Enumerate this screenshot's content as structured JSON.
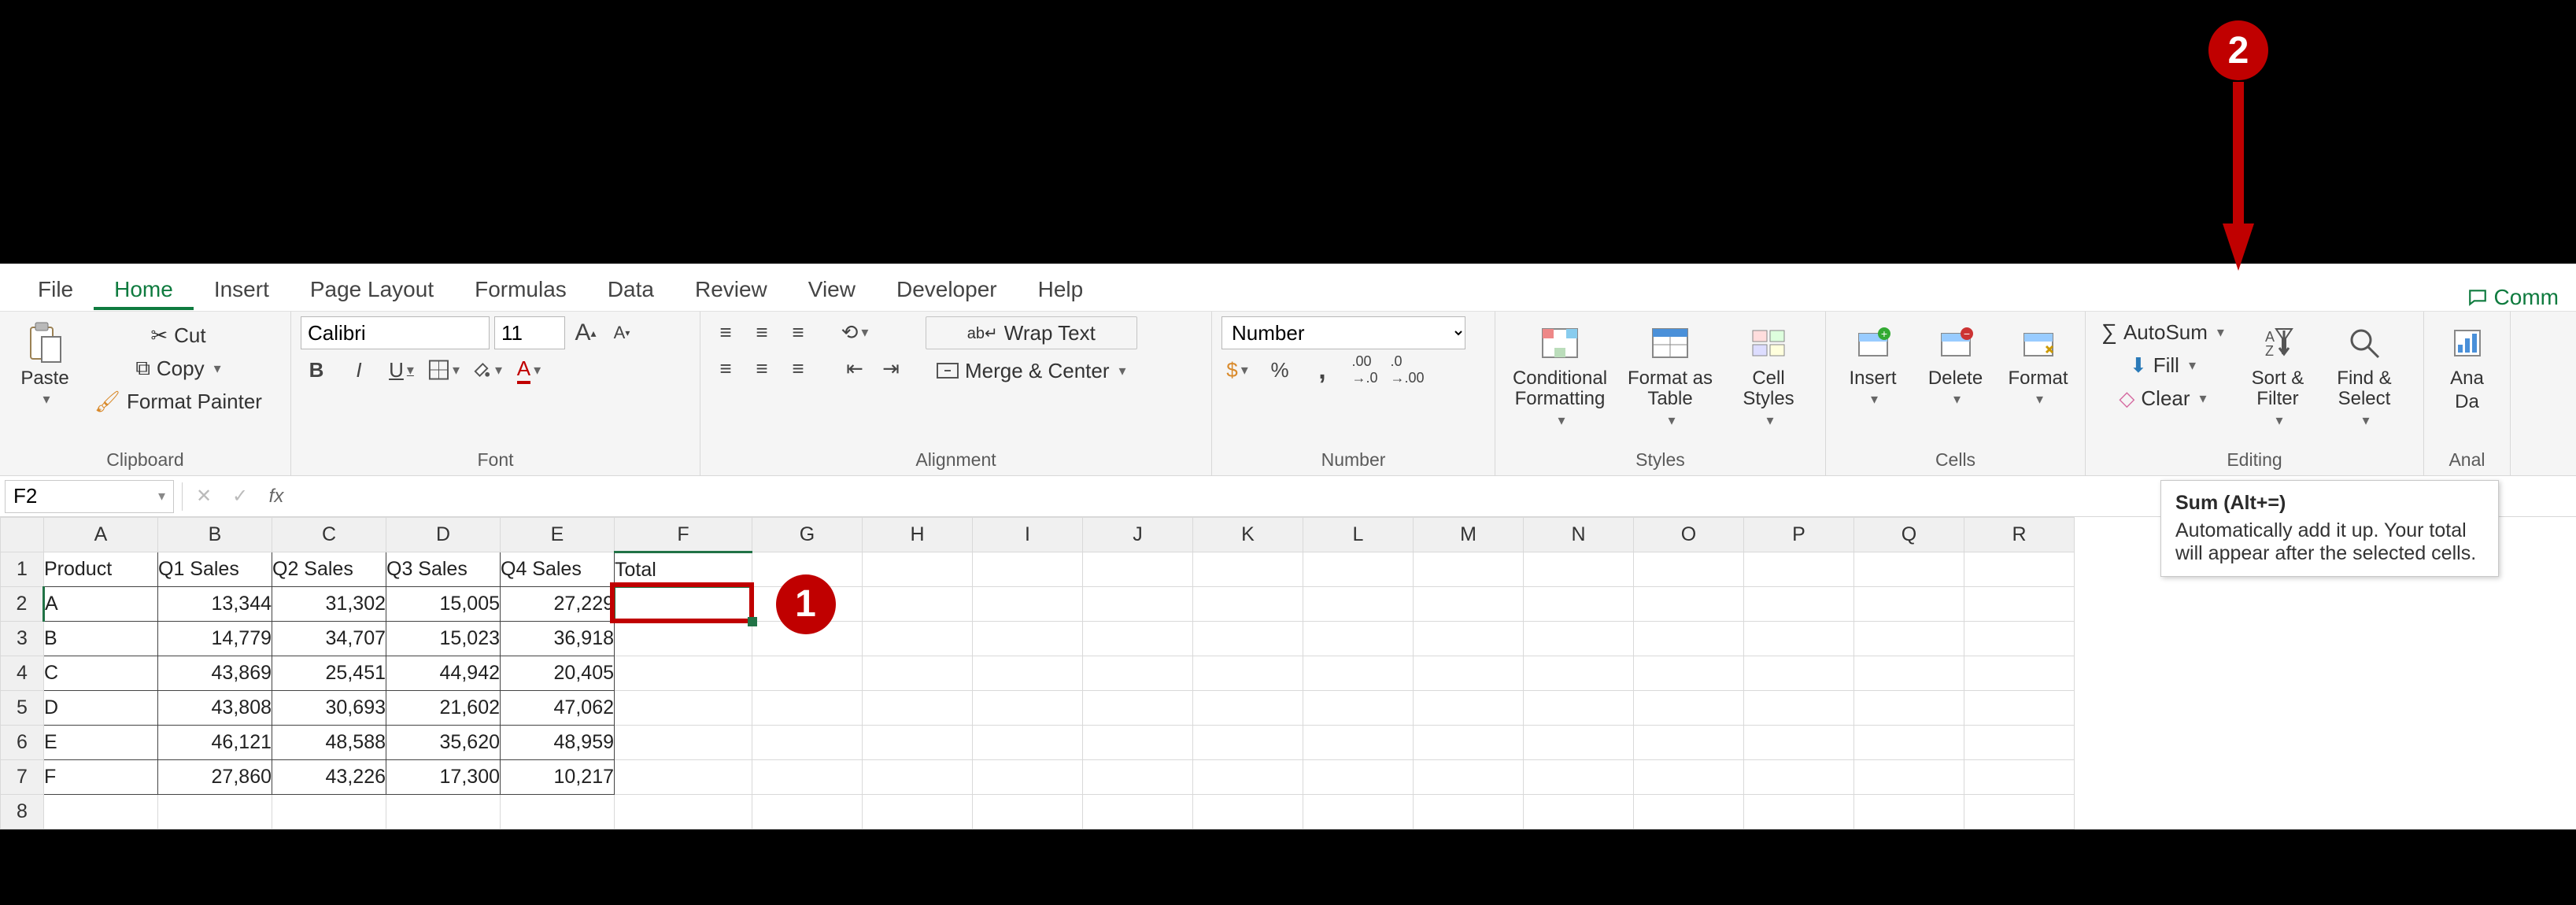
{
  "tabs": {
    "items": [
      "File",
      "Home",
      "Insert",
      "Page Layout",
      "Formulas",
      "Data",
      "Review",
      "View",
      "Developer",
      "Help"
    ],
    "active": "Home",
    "comments_label": "Comm"
  },
  "ribbon": {
    "clipboard": {
      "label": "Clipboard",
      "paste": "Paste",
      "cut": "Cut",
      "copy": "Copy",
      "painter": "Format Painter"
    },
    "font": {
      "label": "Font",
      "name": "Calibri",
      "size": "11",
      "bold": "B",
      "italic": "I",
      "underline": "U"
    },
    "alignment": {
      "label": "Alignment",
      "wrap": "Wrap Text",
      "merge": "Merge & Center"
    },
    "number": {
      "label": "Number",
      "format": "Number",
      "percent": "%",
      "comma": ",",
      "inc": ".00→.0",
      "dec": ".0→.00"
    },
    "styles": {
      "label": "Styles",
      "cond": "Conditional Formatting",
      "table": "Format as Table",
      "cell": "Cell Styles"
    },
    "cells": {
      "label": "Cells",
      "insert": "Insert",
      "delete": "Delete",
      "format": "Format"
    },
    "editing": {
      "label": "Editing",
      "autosum": "AutoSum",
      "fill": "Fill",
      "clear": "Clear",
      "sort": "Sort & Filter",
      "find": "Find & Select"
    },
    "analysis": {
      "label": "Anal",
      "btn1": "Ana",
      "btn2": "Da"
    }
  },
  "formula_bar": {
    "name_box": "F2",
    "cancel": "✕",
    "enter": "✓",
    "fx": "fx",
    "formula": ""
  },
  "grid": {
    "columns": [
      "A",
      "B",
      "C",
      "D",
      "E",
      "F",
      "G",
      "H",
      "I",
      "J",
      "K",
      "L",
      "M",
      "N",
      "O",
      "P",
      "Q",
      "R"
    ],
    "col_widths": {
      "A": 145,
      "B": 145,
      "C": 145,
      "D": 145,
      "E": 145,
      "F": 175,
      "rest": 140
    },
    "headers": [
      "Product",
      "Q1 Sales",
      "Q2 Sales",
      "Q3 Sales",
      "Q4 Sales",
      "Total"
    ],
    "rows": [
      {
        "n": 1
      },
      {
        "n": 2,
        "c": [
          "A",
          "13,344",
          "31,302",
          "15,005",
          "27,229",
          ""
        ]
      },
      {
        "n": 3,
        "c": [
          "B",
          "14,779",
          "34,707",
          "15,023",
          "36,918",
          ""
        ]
      },
      {
        "n": 4,
        "c": [
          "C",
          "43,869",
          "25,451",
          "44,942",
          "20,405",
          ""
        ]
      },
      {
        "n": 5,
        "c": [
          "D",
          "43,808",
          "30,693",
          "21,602",
          "47,062",
          ""
        ]
      },
      {
        "n": 6,
        "c": [
          "E",
          "46,121",
          "48,588",
          "35,620",
          "48,959",
          ""
        ]
      },
      {
        "n": 7,
        "c": [
          "F",
          "27,860",
          "43,226",
          "17,300",
          "10,217",
          ""
        ]
      },
      {
        "n": 8
      }
    ],
    "selected_cell": "F2"
  },
  "tooltip": {
    "title": "Sum (Alt+=)",
    "body": "Automatically add it up. Your total will appear after the selected cells."
  },
  "annotations": {
    "c1": "1",
    "c2": "2"
  }
}
